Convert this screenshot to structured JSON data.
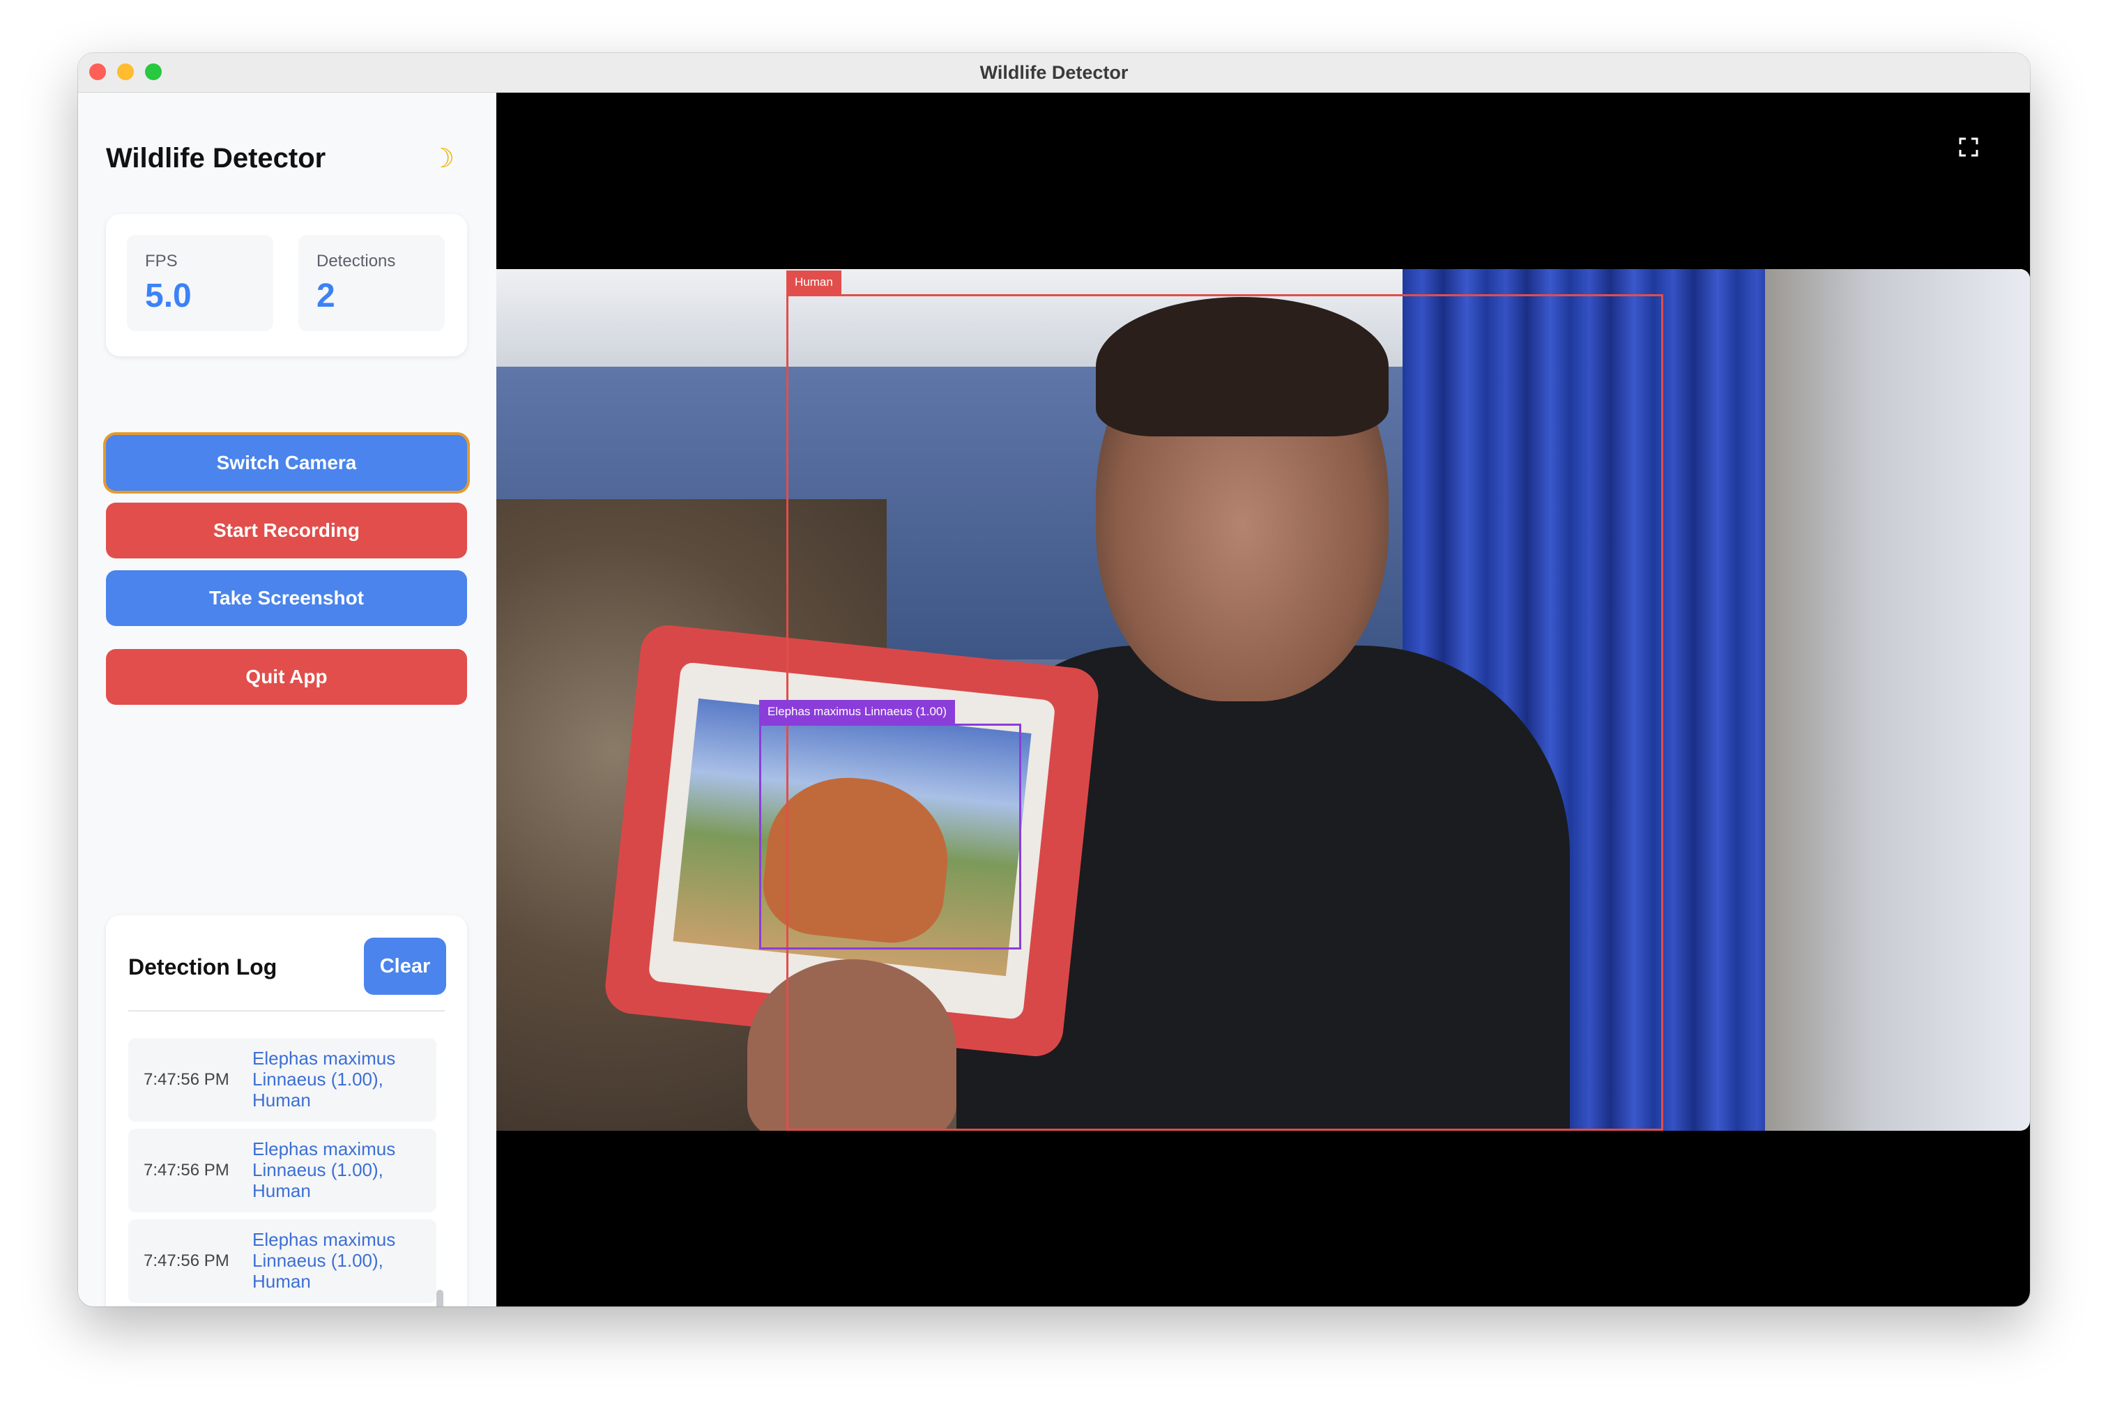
{
  "window": {
    "title": "Wildlife Detector"
  },
  "sidebar": {
    "app_title": "Wildlife Detector",
    "theme_toggle_icon": "moon-icon",
    "stats": [
      {
        "label": "FPS",
        "value": "5.0"
      },
      {
        "label": "Detections",
        "value": "2"
      }
    ],
    "buttons": {
      "switch_camera": "Switch Camera",
      "start_recording": "Start Recording",
      "take_screenshot": "Take Screenshot",
      "quit_app": "Quit App"
    },
    "log": {
      "title": "Detection Log",
      "clear_label": "Clear",
      "entries": [
        {
          "time": "7:47:56 PM",
          "text": "Elephas maximus Linnaeus (1.00), Human"
        },
        {
          "time": "7:47:56 PM",
          "text": "Elephas maximus Linnaeus (1.00), Human"
        },
        {
          "time": "7:47:56 PM",
          "text": "Elephas maximus Linnaeus (1.00), Human"
        }
      ]
    }
  },
  "video": {
    "fullscreen_icon": "fullscreen-icon",
    "detections": [
      {
        "label": "Human"
      },
      {
        "label": "Elephas maximus Linnaeus (1.00)"
      }
    ]
  },
  "colors": {
    "primary_blue": "#4a84ec",
    "danger_red": "#e14e4b",
    "stat_value": "#3b82f6",
    "detection_purple": "#8b3dd9",
    "focus_ring": "#e59a2b"
  }
}
